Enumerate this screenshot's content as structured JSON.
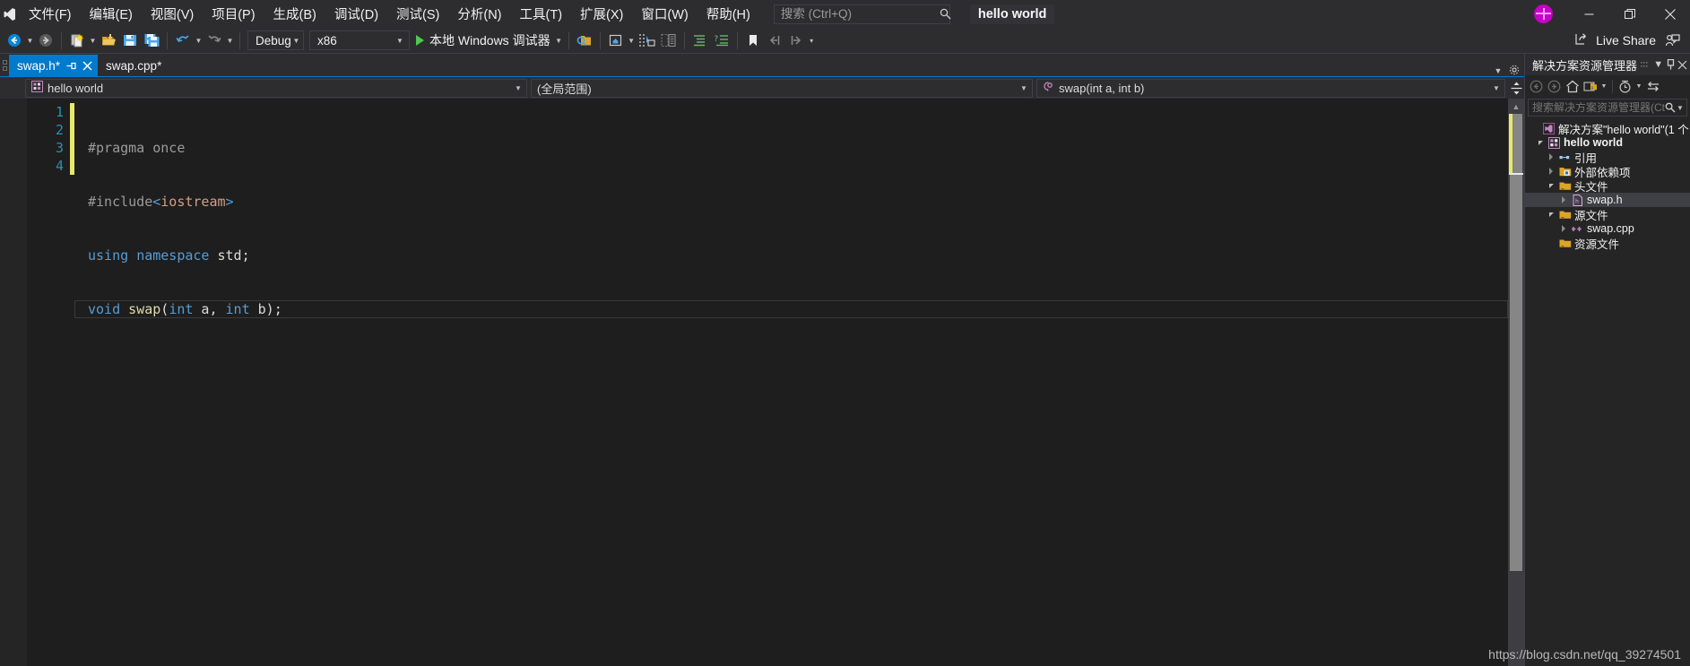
{
  "window": {
    "title": "hello world",
    "logo_icon": "vs-logo-icon",
    "avatar_icon": "user-avatar-icon",
    "minimize_label": "—",
    "maximize_label": "❐",
    "close_label": "✕"
  },
  "menubar": {
    "items": [
      {
        "label": "文件(F)",
        "name": "menu-file"
      },
      {
        "label": "编辑(E)",
        "name": "menu-edit"
      },
      {
        "label": "视图(V)",
        "name": "menu-view"
      },
      {
        "label": "项目(P)",
        "name": "menu-project"
      },
      {
        "label": "生成(B)",
        "name": "menu-build"
      },
      {
        "label": "调试(D)",
        "name": "menu-debug"
      },
      {
        "label": "测试(S)",
        "name": "menu-test"
      },
      {
        "label": "分析(N)",
        "name": "menu-analyze"
      },
      {
        "label": "工具(T)",
        "name": "menu-tools"
      },
      {
        "label": "扩展(X)",
        "name": "menu-extensions"
      },
      {
        "label": "窗口(W)",
        "name": "menu-window"
      },
      {
        "label": "帮助(H)",
        "name": "menu-help"
      }
    ]
  },
  "quick_search": {
    "placeholder": "搜索 (Ctrl+Q)",
    "value": "",
    "icon": "search-icon"
  },
  "toolbar": {
    "nav_back_icon": "navigate-back-icon",
    "nav_forward_icon": "navigate-forward-icon",
    "new_project_icon": "new-project-icon",
    "open_file_icon": "open-file-icon",
    "save_icon": "save-icon",
    "save_all_icon": "save-all-icon",
    "undo_icon": "undo-icon",
    "redo_icon": "redo-icon",
    "config_label": "Debug",
    "platform_label": "x86",
    "run_label": "本地 Windows 调试器",
    "find_icon": "find-in-files-icon",
    "home_icon": "home-icon",
    "step_icon": "step-into-icon",
    "compare_icon": "compare-icon",
    "indent_icon": "indent-icon",
    "comment_icon": "comment-icon",
    "bookmark_icon": "bookmark-icon",
    "prev_bookmark_icon": "previous-bookmark-icon",
    "next_bookmark_icon": "next-bookmark-icon",
    "overflow_icon": "toolbar-overflow-icon",
    "live_share_label": "Live Share",
    "live_share_icon": "live-share-icon",
    "feedback_icon": "send-feedback-icon"
  },
  "tabs": {
    "items": [
      {
        "label": "swap.h*",
        "active": true,
        "name": "tab-swap-h"
      },
      {
        "label": "swap.cpp*",
        "active": false,
        "name": "tab-swap-cpp"
      }
    ],
    "pin_icon": "pin-icon",
    "close_icon": "close-tab-icon",
    "dropdown_icon": "tab-list-icon"
  },
  "navbar": {
    "project": "hello world",
    "project_icon": "project-icon",
    "scope": "(全局范围)",
    "member": "swap(int a, int b)",
    "member_icon": "method-icon",
    "split_icon": "split-editor-icon",
    "arrow_icon": "chevron-down-icon"
  },
  "editor": {
    "lines": [
      {
        "number": "1",
        "tokens": [
          {
            "t": "#pragma once",
            "c": "tok-pp"
          }
        ]
      },
      {
        "number": "2",
        "tokens": [
          {
            "t": "#include",
            "c": "tok-pp"
          },
          {
            "t": "<",
            "c": "tok-kw"
          },
          {
            "t": "iostream",
            "c": "tok-str"
          },
          {
            "t": ">",
            "c": "tok-kw"
          }
        ]
      },
      {
        "number": "3",
        "tokens": [
          {
            "t": "using",
            "c": "tok-kw"
          },
          {
            "t": " ",
            "c": "tok-punc"
          },
          {
            "t": "namespace",
            "c": "tok-kw"
          },
          {
            "t": " std;",
            "c": "tok-id"
          }
        ]
      },
      {
        "number": "4",
        "current": true,
        "tokens": [
          {
            "t": "void",
            "c": "tok-kw"
          },
          {
            "t": " ",
            "c": "tok-punc"
          },
          {
            "t": "swap",
            "c": "tok-fn"
          },
          {
            "t": "(",
            "c": "tok-punc"
          },
          {
            "t": "int",
            "c": "tok-kw"
          },
          {
            "t": " a, ",
            "c": "tok-id"
          },
          {
            "t": "int",
            "c": "tok-kw"
          },
          {
            "t": " b);",
            "c": "tok-id"
          }
        ]
      }
    ],
    "scroll_up_icon": "scroll-up-icon"
  },
  "solution_explorer": {
    "title": "解决方案资源管理器",
    "dots_icon": "drag-handle-icon",
    "dropdown_icon": "window-menu-icon",
    "pin_icon": "pin-window-icon",
    "close_icon": "close-window-icon",
    "back_icon": "back-icon",
    "forward_icon": "forward-icon",
    "home_icon": "home-icon",
    "show_all_icon": "show-all-files-icon",
    "pending_icon": "pending-changes-icon",
    "sync_icon": "sync-with-active-document-icon",
    "search_placeholder": "搜索解决方案资源管理器(Ctr",
    "search_value": "",
    "search_icon": "search-icon",
    "search_arrow_icon": "chevron-down-icon",
    "tree": [
      {
        "label": "解决方案\"hello world\"(1 个",
        "indent": 0,
        "expander": "none",
        "icon": "solution-icon",
        "bold": false,
        "selected": false,
        "name": "tree-item-solution"
      },
      {
        "label": "hello world",
        "indent": 1,
        "expander": "down",
        "icon": "cpp-project-icon",
        "bold": true,
        "selected": false,
        "name": "tree-item-project"
      },
      {
        "label": "引用",
        "indent": 2,
        "expander": "right",
        "icon": "references-icon",
        "bold": false,
        "selected": false,
        "name": "tree-item-references"
      },
      {
        "label": "外部依赖项",
        "indent": 2,
        "expander": "right",
        "icon": "external-dependencies-icon",
        "bold": false,
        "selected": false,
        "name": "tree-item-external-dependencies"
      },
      {
        "label": "头文件",
        "indent": 2,
        "expander": "down",
        "icon": "folder-filter-icon",
        "bold": false,
        "selected": false,
        "name": "tree-item-header-files"
      },
      {
        "label": "swap.h",
        "indent": 3,
        "expander": "right",
        "icon": "h-file-icon",
        "bold": false,
        "selected": true,
        "name": "tree-item-swap-h"
      },
      {
        "label": "源文件",
        "indent": 2,
        "expander": "down",
        "icon": "folder-filter-icon",
        "bold": false,
        "selected": false,
        "name": "tree-item-source-files"
      },
      {
        "label": "swap.cpp",
        "indent": 3,
        "expander": "right",
        "icon": "cpp-file-icon",
        "bold": false,
        "selected": false,
        "name": "tree-item-swap-cpp"
      },
      {
        "label": "资源文件",
        "indent": 2,
        "expander": "none",
        "icon": "folder-filter-icon",
        "bold": false,
        "selected": false,
        "name": "tree-item-resource-files"
      }
    ]
  },
  "watermark": {
    "text": "https://blog.csdn.net/qq_39274501"
  },
  "colors": {
    "accent": "#007acc",
    "chrome": "#2d2d30",
    "editor_bg": "#1e1e1e",
    "panel_bg": "#252526",
    "keyword": "#569cd6",
    "string": "#d69d85",
    "function": "#dcdcaa",
    "linenumber": "#2b91af",
    "changebar": "#e8e86b"
  }
}
